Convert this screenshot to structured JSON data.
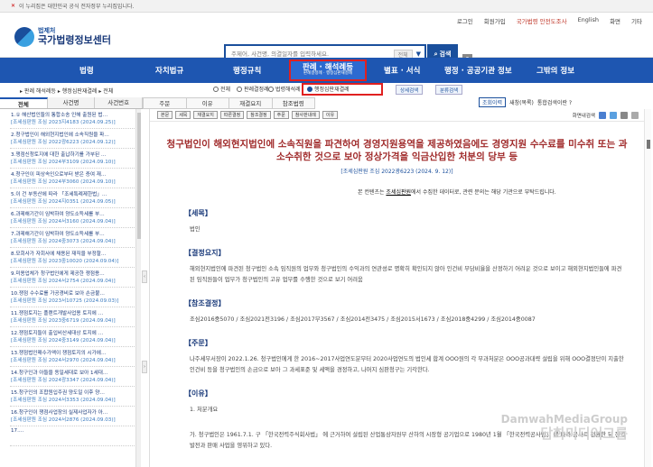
{
  "gov_banner": {
    "flag": "✕",
    "text": "이 누리집은 대한민국 공식 전자정부 누리집입니다."
  },
  "util_links": [
    "로그인",
    "회원가입",
    "국가법령 안전도조사",
    "English",
    "화면",
    "기타"
  ],
  "logo": {
    "small": "법제처",
    "big": "국가법령정보센터"
  },
  "search": {
    "placeholder": "주제어, 사건명, 의결일자를 입력하세요.",
    "option": "전체",
    "button": "검색",
    "help": "?"
  },
  "main_nav": [
    "법령",
    "자치법규",
    "행정규칙",
    "판례 · 해석례등",
    "별표 · 서식",
    "행정 · 공공기관 정보",
    "그밖의 정보"
  ],
  "main_nav_active_sub": "판례결정례 · 행정심판재결례",
  "breadcrumb": "▸ 판례 해석례등 ▸ 행정심판재결례 ▸ 전체",
  "radios": [
    {
      "label": "전체",
      "on": false
    },
    {
      "label": "판례결정례",
      "on": false
    },
    {
      "label": "법령해석례",
      "on": false
    },
    {
      "label": "행정심판재결례",
      "on": true
    }
  ],
  "buttons": {
    "detail": "상세검색",
    "related": "분류검색",
    "zoom": "조회이력",
    "new_window": "새창(목록)",
    "help2": "통합검색이란 ?"
  },
  "tabs": [
    "전체",
    "사건명",
    "사건번호"
  ],
  "tabs2": [
    "주문",
    "이유",
    "재결요지",
    "참조법령"
  ],
  "list": [
    {
      "t": "1.① 해산법인들의 통합소송 인해 출원된 법…",
      "s": "[조세심판원 조심 2023지4183 (2024.09.25)]"
    },
    {
      "t": "2.청구법인이 해외현지법인에 소속직원을 파…",
      "s": "[조세심판원 조심 2022광6223 (2024.09.12)]"
    },
    {
      "t": "3.쟁점신청토지에 대한 출납하기를 가부된 …",
      "s": "[조세심판원 조심 2024부3109 (2024.09.10)]"
    },
    {
      "t": "4.청구인이 피상속인으로부터 받은 증여 재…",
      "s": "[조세심판원 조심 2024부3060 (2024.09.10)]"
    },
    {
      "t": "5.이 건 부동산에 따라 「조세특례제한법」…",
      "s": "[조세심판원 조심 2024지0351 (2024.09.05)]"
    },
    {
      "t": "6.과제해기간이 임박하여 양도소득세를 부…",
      "s": "[조세심판원 조심 2024서3160 (2024.09.04)]"
    },
    {
      "t": "7.과제해기간이 임박하여 양도소득세를 부…",
      "s": "[조세심판원 조심 2024중3073 (2024.09.04)]"
    },
    {
      "t": "8.모회사가 자회사에 채용된 재직을 부정할…",
      "s": "[조세심판원 조심 2023중10020 (2024.09.04)]"
    },
    {
      "t": "9.미용업체가 청구법인에게 제공한 쟁점용…",
      "s": "[조세심판원 조심 2024서2754 (2024.09.04)]"
    },
    {
      "t": "10.쟁점 수수료를 가공경비로 보아 손금불…",
      "s": "[조세심판원 조심 2023서10725 (2024.09.03)]"
    },
    {
      "t": "11.쟁점토지는 플랜트개발사업용 토지에 …",
      "s": "[조세심판원 조심 2023중6719 (2024.09.04)]"
    },
    {
      "t": "12.쟁점토지들이 출입비산세대상 토지에 …",
      "s": "[조세심판원 조심 2024중3149 (2024.09.04)]"
    },
    {
      "t": "13.쟁점법인매수가액이 쟁점토지의 시가에…",
      "s": "[조세심판원 조심 2024서2970 (2024.09.04)]"
    },
    {
      "t": "14.청구인과 아들을 동일세대로 보아 1세대…",
      "s": "[조세심판원 조심 2024광3347 (2024.09.04)]"
    },
    {
      "t": "15.청구인의 조합원입주권 양도일 이후 양…",
      "s": "[조세심판원 조심 2024서3353 (2024.09.04)]"
    },
    {
      "t": "16.청구인이 쟁점사업장의 실제사업자가 아…",
      "s": "[조세심판원 조심 2024서2876 (2024.09.03)]"
    },
    {
      "t": "17.…",
      "s": ""
    }
  ],
  "content_toolbar": [
    "본문",
    "세목",
    "재결요지",
    "따른결정",
    "참조결정",
    "주문",
    "참사판내례",
    "이유"
  ],
  "content_toolbar_right": "화면내검색",
  "doc": {
    "title": "청구법인이 해외현지법인에 소속직원을 파견하여 경영지원용역을 제공하였음에도 경영지원 수수료를 미수취 또는 과소수취한 것으로 보아 정상가격을 익금산입한 처분의 당부 등",
    "meta": "[조세심판원 조심 2022광6223 (2024. 9. 12)]",
    "notice_pre": "본 컨텐츠는 ",
    "notice_link": "조세심판원",
    "notice_post": "에서 수집한 데이터로, 관련 문의는 해당 기관으로 부탁드립니다.",
    "sections": [
      {
        "h": "【세목】",
        "b": "법인"
      },
      {
        "h": "【결정요지】",
        "b": "해외현지법인에 파견된 청구법인 소속 임직원의 업무와 청구법인의 수익과의 연관성로 명확히 확인되지 않아 인건비 부담비율을 산정하기 어려운 것으로 보이고 해외현지법인들에 파견된 임직원들이 업무가 청구법인의 고유 업무를 수행한 것으로 보기 어려움"
      },
      {
        "h": "【참조결정】",
        "b": "조심2016중5070 / 조심2021전3196 / 조심2017부3567 / 조심2014전3475 / 조심2015서1673 / 조심2018중4299 / 조심2014중0087"
      },
      {
        "h": "【주문】",
        "b": "나주세무서장이 2022.1.26. 청구법인에게 한 2016~2017사업연도분부터 2020사업연도의 법인세 합계 OOO원의 각 부과처분은 OOO공과대략 설립을 위해 OOO결정단이 지출한 인건비 등을 청구법인의 손금으로 보아 그 과세표준 및 세액을 경정하고, 나머지 심판청구는 기각한다."
      },
      {
        "h": "【이유】",
        "b": "1. 처분개요"
      }
    ],
    "last_para": "가. 청구법인은 1961.7.1. 구 「한국전력주식회사법」 에 근거하여 설립된 산업통상자원부 산하의 시장형 공기업으로 1980년 1월 「한국전력공사법」 에 따라 공사로 전환한 뒤 전력발전과 판매 사업을 영위하고 있다."
  },
  "watermark": {
    "en": "DamwahMediaGroup",
    "ko": "담화미디어그룹"
  }
}
